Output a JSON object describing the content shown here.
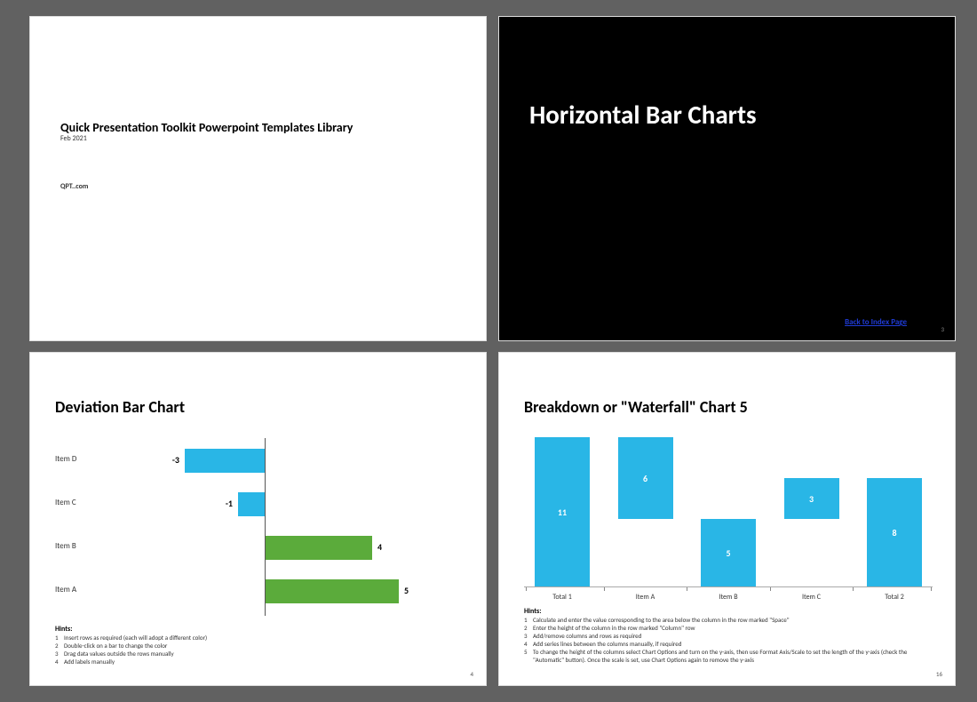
{
  "slide1": {
    "title": "Quick Presentation Toolkit Powerpoint Templates Library",
    "date": "Feb 2021",
    "site": "QPT..com"
  },
  "slide2": {
    "title": "Horizontal Bar Charts",
    "link": "Back to Index Page",
    "page": "3"
  },
  "slide3": {
    "title": "Deviation Bar Chart",
    "hints_header": "Hints:",
    "hints": [
      "Insert rows as required (each will adopt a different color)",
      "Double-click on a bar to change the color",
      "Drag data values outside the rows manually",
      "Add labels manually"
    ],
    "page": "4"
  },
  "slide4": {
    "title": "Breakdown or \"Waterfall\" Chart 5",
    "hints_header": "Hints:",
    "hints": [
      "Calculate and enter the value corresponding to the area below the column in the row marked \"Space\"",
      "Enter the height of the column in the row marked \"Column\" row",
      "Add/remove columns and rows as required",
      "Add series lines between the columns manually, if required",
      "To change the height of the columns select Chart Options and turn on the y-axis, then use Format Axis/Scale to set the length of the y-axis (check the \"Automatic\" button). Once the scale is set, use Chart Options again to remove the y-axis"
    ],
    "page": "16"
  },
  "chart_data": [
    {
      "type": "bar",
      "orientation": "horizontal",
      "title": "Deviation Bar Chart",
      "categories": [
        "Item D",
        "Item C",
        "Item B",
        "Item A"
      ],
      "values": [
        -3,
        -1,
        4,
        5
      ],
      "colors": [
        "#29b6e6",
        "#29b6e6",
        "#5bab3b",
        "#5bab3b"
      ],
      "xlim": [
        -5,
        5
      ]
    },
    {
      "type": "bar",
      "subtype": "waterfall",
      "title": "Breakdown or \"Waterfall\" Chart 5",
      "categories": [
        "Total 1",
        "Item A",
        "Item B",
        "Item C",
        "Total 2"
      ],
      "values": [
        11,
        6,
        5,
        3,
        8
      ],
      "bases": [
        0,
        5,
        0,
        5,
        0
      ],
      "ylim": [
        0,
        11
      ]
    }
  ]
}
